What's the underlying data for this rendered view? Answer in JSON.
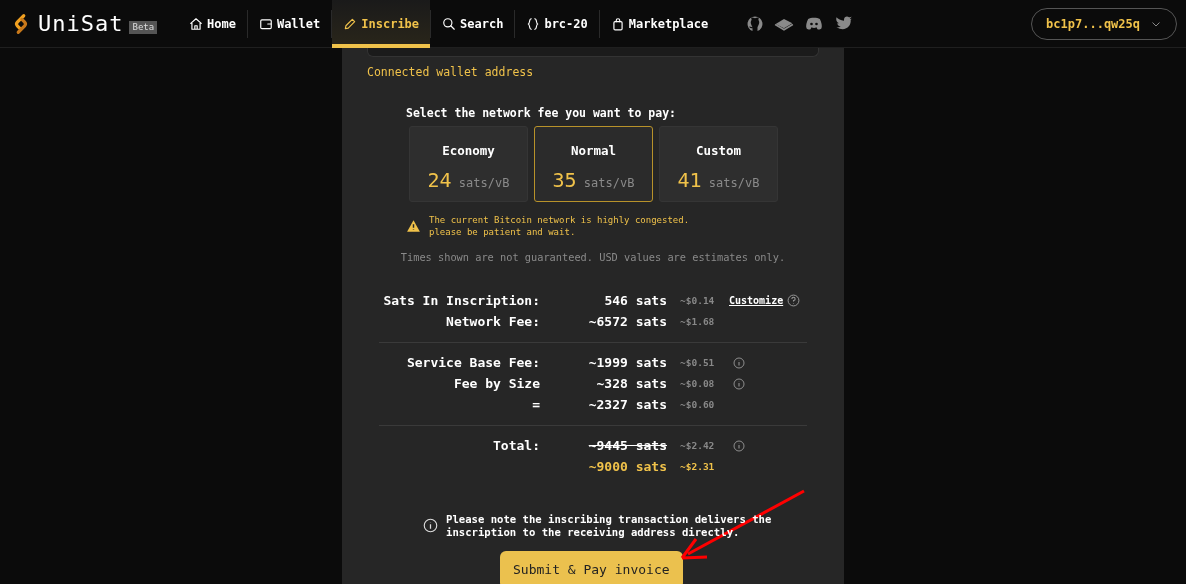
{
  "header": {
    "logo": "UniSat",
    "badge": "Beta",
    "nav": [
      {
        "label": "Home",
        "selected": false
      },
      {
        "label": "Wallet",
        "selected": false
      },
      {
        "label": "Inscribe",
        "selected": true
      },
      {
        "label": "Search",
        "selected": false
      },
      {
        "label": "brc-20",
        "selected": false
      },
      {
        "label": "Marketplace",
        "selected": false
      }
    ],
    "wallet": "bc1p7...qw25q"
  },
  "form": {
    "wallet_hint": "Connected wallet address",
    "fee_prompt": "Select the network fee you want to pay:",
    "fee_options": [
      {
        "name": "Economy",
        "rate": "24",
        "unit": "sats/vB",
        "selected": false
      },
      {
        "name": "Normal",
        "rate": "35",
        "unit": "sats/vB",
        "selected": true
      },
      {
        "name": "Custom",
        "rate": "41",
        "unit": "sats/vB",
        "selected": false
      }
    ],
    "warning": "The current Bitcoin network is highly congested.\nplease be patient and wait.",
    "disclaimer": "Times shown are not guaranteed. USD values are estimates only.",
    "fee_groups": [
      [
        {
          "label": "Sats In Inscription:",
          "sats": "546 sats",
          "usd": "~$0.14",
          "kind": "plain",
          "info": false,
          "action": "Customize"
        },
        {
          "label": "Network Fee:",
          "sats": "~6572 sats",
          "usd": "~$1.68",
          "kind": "plain",
          "info": false
        }
      ],
      [
        {
          "label": "Service Base Fee:",
          "sats": "~1999 sats",
          "usd": "~$0.51",
          "kind": "plain",
          "info": true
        },
        {
          "label": "Fee by Size",
          "sats": "~328 sats",
          "usd": "~$0.08",
          "kind": "plain",
          "info": true
        },
        {
          "label": "=",
          "sats": "~2327 sats",
          "usd": "~$0.60",
          "kind": "plain",
          "info": false
        }
      ],
      [
        {
          "label": "Total:",
          "sats": "~9445 sats",
          "usd": "~$2.42",
          "kind": "struck",
          "info": true
        },
        {
          "sats": "~9000 sats",
          "usd": "~$2.31",
          "kind": "discount",
          "info": false
        }
      ]
    ],
    "note": "Please note the inscribing transaction delivers the inscription to the receiving address directly.",
    "submit": "Submit & Pay invoice"
  }
}
